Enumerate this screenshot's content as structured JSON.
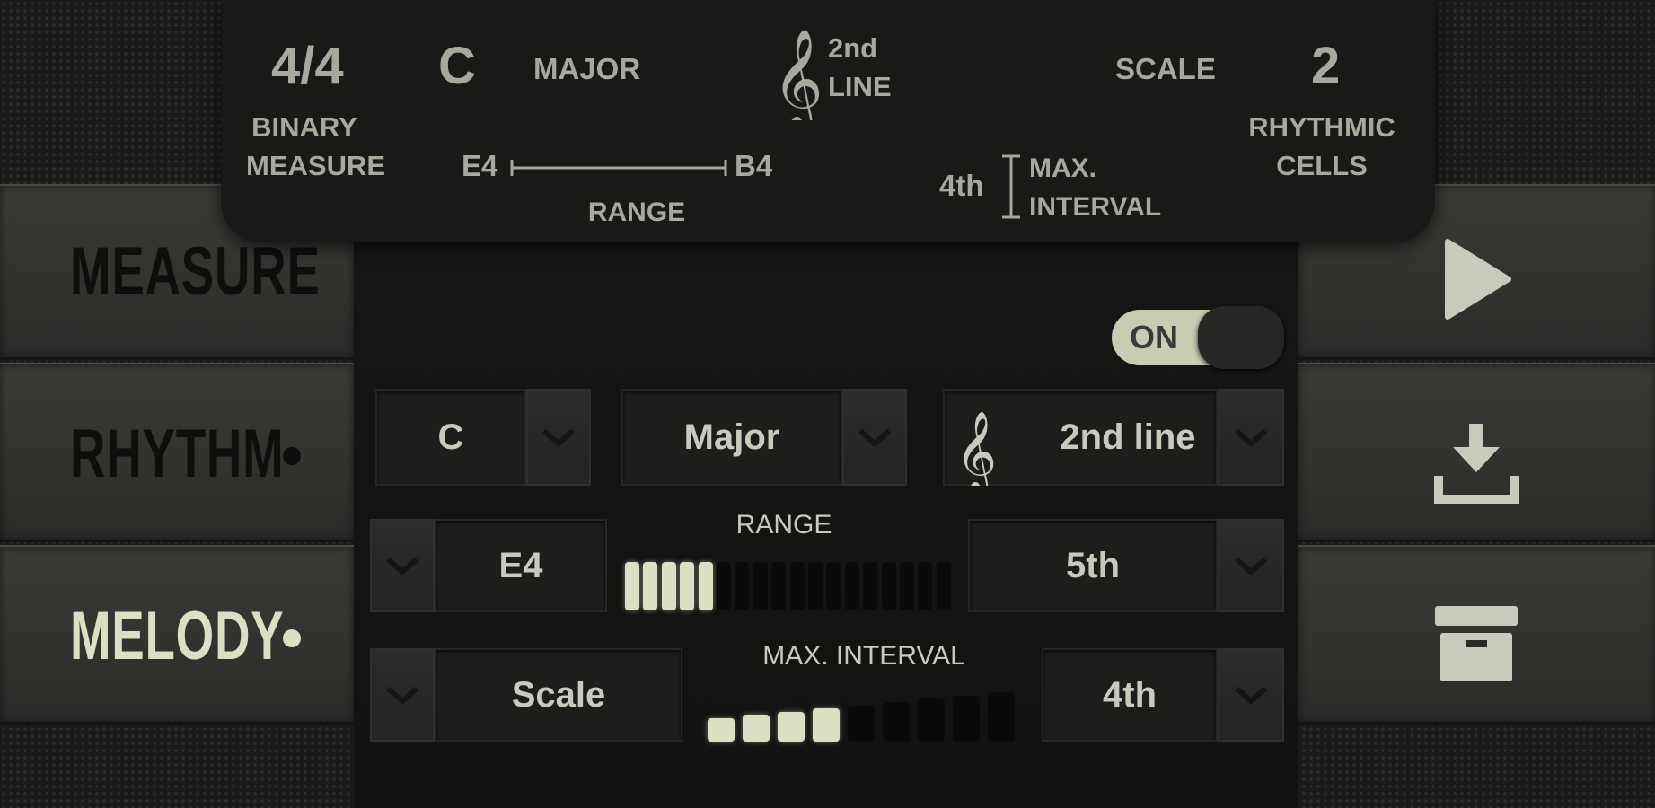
{
  "summary": {
    "time_signature": "4/4",
    "measure_type_line1": "BINARY",
    "measure_type_line2": "MEASURE",
    "key": "C",
    "mode": "MAJOR",
    "clef_line1": "2nd",
    "clef_line2": "LINE",
    "mode_type": "SCALE",
    "rhythmic_cells_count": "2",
    "rhythmic_cells_line1": "RHYTHMIC",
    "rhythmic_cells_line2": "CELLS",
    "range_low": "E4",
    "range_high": "B4",
    "range_label": "RANGE",
    "max_interval": "4th",
    "max_interval_line1": "MAX.",
    "max_interval_line2": "INTERVAL"
  },
  "sidebar": {
    "items": [
      {
        "label": "MEASURE",
        "active": false
      },
      {
        "label": "RHYTHM",
        "active": false
      },
      {
        "label": "MELODY",
        "active": true
      }
    ]
  },
  "controls": {
    "toggle_label": "ON",
    "key_select": "C",
    "mode_select": "Major",
    "clef_select": "2nd line",
    "range_low_select": "E4",
    "range_label": "RANGE",
    "range_high_select": "5th",
    "range_level": {
      "filled": 5,
      "total": 18
    },
    "motion_select": "Scale",
    "max_interval_label": "MAX. INTERVAL",
    "max_interval_select": "4th",
    "max_interval_level": {
      "filled": 4,
      "total": 9
    }
  },
  "actions": {
    "play_icon": "play-icon",
    "download_icon": "download-icon",
    "archive_icon": "archive-icon"
  },
  "colors": {
    "active_text": "#dcdfc4",
    "inactive_text": "#0e0e0d",
    "accent": "#dcdfc4"
  }
}
